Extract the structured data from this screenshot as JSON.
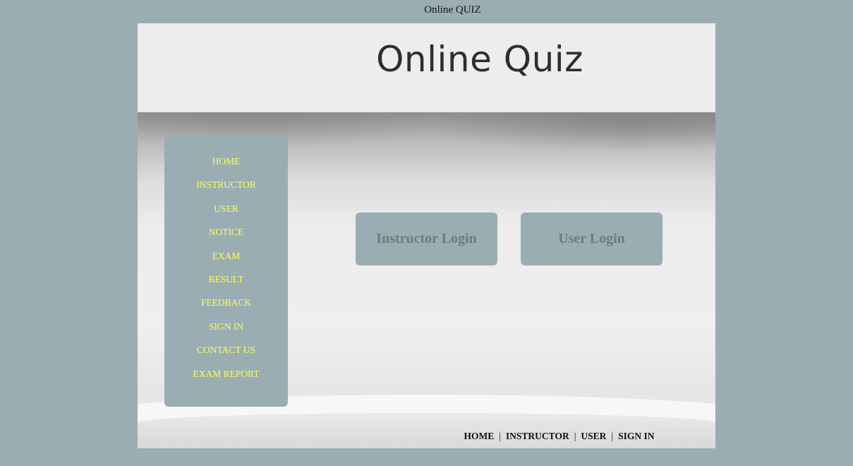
{
  "page_title": "Online QUIZ",
  "header": {
    "title": "Online Quiz"
  },
  "sidebar": {
    "items": [
      {
        "label": "HOME"
      },
      {
        "label": "INSTRUCTOR"
      },
      {
        "label": "USER"
      },
      {
        "label": "NOTICE"
      },
      {
        "label": "EXAM"
      },
      {
        "label": "RESULT"
      },
      {
        "label": "FEEDBACK"
      },
      {
        "label": "SIGN IN"
      },
      {
        "label": "CONTACT US"
      },
      {
        "label": "EXAM REPORT"
      }
    ]
  },
  "main": {
    "buttons": {
      "instructor_login": "Instructor Login",
      "user_login": "User Login"
    }
  },
  "footer": {
    "links": [
      {
        "label": "HOME"
      },
      {
        "label": "INSTRUCTOR"
      },
      {
        "label": "USER"
      },
      {
        "label": "SIGN IN"
      }
    ],
    "separator": "|"
  },
  "colors": {
    "background": "#9aadb3",
    "sidebar_link": "#ffff55",
    "button_text": "#6f7a7d",
    "header_text": "#2e2e2e"
  }
}
